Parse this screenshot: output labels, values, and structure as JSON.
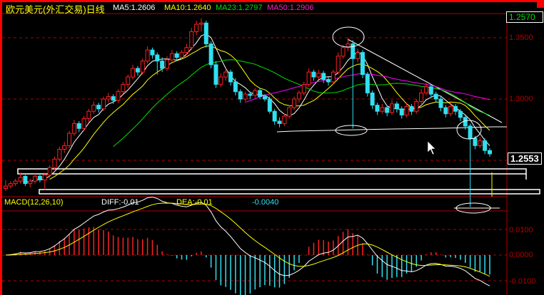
{
  "header": {
    "title": "欧元美元(外汇交易)日线",
    "ma5": "MA5:1.2606",
    "ma10": "MA10:1.2640",
    "ma23": "MA23:1.2797",
    "ma50": "MA50:1.2906"
  },
  "macd_header": {
    "name": "MACD(12,26,10)",
    "diff": "DIFF:-0.01",
    "dea": "DEA:-0.01",
    "macd": "-0.0040"
  },
  "price_axis": {
    "top_value": "1.2570",
    "ticks": [
      "1.3500",
      "1.3000"
    ],
    "current_price": "1.2553"
  },
  "macd_axis": {
    "ticks": [
      "0.0100",
      "0.0000",
      "-0.0100"
    ]
  },
  "colors": {
    "up": "#ff2020",
    "down": "#30e0f0",
    "ma5": "#ffffff",
    "ma10": "#ffff00",
    "ma23": "#00e000",
    "ma50": "#ff00ff",
    "grid": "#b00000"
  },
  "chart_data": {
    "type": "candlestick",
    "ylim": [
      1.21,
      1.37
    ],
    "yticks": [
      1.35,
      1.3,
      1.25
    ],
    "macd_yticks": [
      0.01,
      0,
      -0.01
    ],
    "grid": true,
    "moving_averages": [
      5,
      10,
      23,
      50
    ],
    "macd_params": [
      12,
      26,
      10
    ],
    "candles_ohlc": [
      [
        1.227,
        1.234,
        1.225,
        1.229
      ],
      [
        1.229,
        1.233,
        1.227,
        1.231
      ],
      [
        1.231,
        1.235,
        1.229,
        1.233
      ],
      [
        1.233,
        1.24,
        1.231,
        1.236
      ],
      [
        1.237,
        1.238,
        1.229,
        1.231
      ],
      [
        1.231,
        1.235,
        1.228,
        1.233
      ],
      [
        1.233,
        1.239,
        1.231,
        1.237
      ],
      [
        1.237,
        1.239,
        1.232,
        1.234
      ],
      [
        1.234,
        1.24,
        1.226,
        1.238
      ],
      [
        1.238,
        1.246,
        1.236,
        1.244
      ],
      [
        1.244,
        1.253,
        1.242,
        1.251
      ],
      [
        1.251,
        1.261,
        1.249,
        1.259
      ],
      [
        1.259,
        1.265,
        1.256,
        1.262
      ],
      [
        1.262,
        1.274,
        1.26,
        1.272
      ],
      [
        1.272,
        1.283,
        1.27,
        1.28
      ],
      [
        1.28,
        1.282,
        1.273,
        1.276
      ],
      [
        1.276,
        1.286,
        1.274,
        1.284
      ],
      [
        1.284,
        1.292,
        1.281,
        1.29
      ],
      [
        1.29,
        1.298,
        1.288,
        1.295
      ],
      [
        1.295,
        1.297,
        1.289,
        1.292
      ],
      [
        1.292,
        1.302,
        1.29,
        1.3
      ],
      [
        1.3,
        1.305,
        1.297,
        1.302
      ],
      [
        1.302,
        1.304,
        1.296,
        1.299
      ],
      [
        1.299,
        1.308,
        1.297,
        1.306
      ],
      [
        1.306,
        1.314,
        1.304,
        1.312
      ],
      [
        1.312,
        1.32,
        1.309,
        1.318
      ],
      [
        1.318,
        1.328,
        1.316,
        1.325
      ],
      [
        1.325,
        1.327,
        1.319,
        1.322
      ],
      [
        1.322,
        1.333,
        1.32,
        1.331
      ],
      [
        1.331,
        1.343,
        1.329,
        1.34
      ],
      [
        1.34,
        1.342,
        1.333,
        1.336
      ],
      [
        1.336,
        1.338,
        1.32,
        1.331
      ],
      [
        1.331,
        1.334,
        1.322,
        1.325
      ],
      [
        1.325,
        1.335,
        1.323,
        1.332
      ],
      [
        1.332,
        1.34,
        1.33,
        1.337
      ],
      [
        1.337,
        1.339,
        1.331,
        1.334
      ],
      [
        1.334,
        1.34,
        1.332,
        1.338
      ],
      [
        1.338,
        1.345,
        1.336,
        1.342
      ],
      [
        1.342,
        1.358,
        1.34,
        1.355
      ],
      [
        1.355,
        1.364,
        1.352,
        1.361
      ],
      [
        1.361,
        1.366,
        1.355,
        1.362
      ],
      [
        1.362,
        1.364,
        1.342,
        1.345
      ],
      [
        1.345,
        1.347,
        1.325,
        1.328
      ],
      [
        1.328,
        1.331,
        1.309,
        1.312
      ],
      [
        1.312,
        1.321,
        1.31,
        1.318
      ],
      [
        1.318,
        1.325,
        1.315,
        1.322
      ],
      [
        1.322,
        1.324,
        1.311,
        1.314
      ],
      [
        1.314,
        1.317,
        1.303,
        1.306
      ],
      [
        1.306,
        1.308,
        1.297,
        1.3
      ],
      [
        1.3,
        1.306,
        1.298,
        1.304
      ],
      [
        1.304,
        1.306,
        1.3,
        1.303
      ],
      [
        1.303,
        1.309,
        1.301,
        1.307
      ],
      [
        1.307,
        1.309,
        1.3,
        1.302
      ],
      [
        1.302,
        1.304,
        1.298,
        1.3
      ],
      [
        1.3,
        1.302,
        1.288,
        1.29
      ],
      [
        1.29,
        1.292,
        1.279,
        1.282
      ],
      [
        1.282,
        1.285,
        1.277,
        1.28
      ],
      [
        1.28,
        1.288,
        1.278,
        1.286
      ],
      [
        1.286,
        1.295,
        1.284,
        1.293
      ],
      [
        1.293,
        1.302,
        1.291,
        1.3
      ],
      [
        1.3,
        1.307,
        1.297,
        1.305
      ],
      [
        1.305,
        1.314,
        1.303,
        1.312
      ],
      [
        1.312,
        1.325,
        1.31,
        1.322
      ],
      [
        1.322,
        1.324,
        1.315,
        1.318
      ],
      [
        1.318,
        1.324,
        1.316,
        1.321
      ],
      [
        1.321,
        1.323,
        1.313,
        1.316
      ],
      [
        1.316,
        1.318,
        1.311,
        1.314
      ],
      [
        1.314,
        1.324,
        1.312,
        1.322
      ],
      [
        1.322,
        1.338,
        1.32,
        1.335
      ],
      [
        1.335,
        1.344,
        1.333,
        1.342
      ],
      [
        1.342,
        1.35,
        1.339,
        1.345
      ],
      [
        1.345,
        1.348,
        1.276,
        1.333
      ],
      [
        1.333,
        1.341,
        1.33,
        1.338
      ],
      [
        1.338,
        1.34,
        1.317,
        1.32
      ],
      [
        1.32,
        1.322,
        1.302,
        1.305
      ],
      [
        1.305,
        1.307,
        1.292,
        1.295
      ],
      [
        1.295,
        1.297,
        1.287,
        1.29
      ],
      [
        1.29,
        1.296,
        1.288,
        1.293
      ],
      [
        1.293,
        1.295,
        1.286,
        1.289
      ],
      [
        1.289,
        1.299,
        1.287,
        1.296
      ],
      [
        1.296,
        1.298,
        1.289,
        1.292
      ],
      [
        1.292,
        1.294,
        1.284,
        1.287
      ],
      [
        1.287,
        1.297,
        1.285,
        1.294
      ],
      [
        1.294,
        1.296,
        1.287,
        1.29
      ],
      [
        1.29,
        1.3,
        1.288,
        1.298
      ],
      [
        1.298,
        1.308,
        1.296,
        1.305
      ],
      [
        1.305,
        1.313,
        1.303,
        1.31
      ],
      [
        1.31,
        1.312,
        1.301,
        1.304
      ],
      [
        1.304,
        1.306,
        1.297,
        1.3
      ],
      [
        1.3,
        1.302,
        1.29,
        1.293
      ],
      [
        1.293,
        1.295,
        1.285,
        1.288
      ],
      [
        1.288,
        1.297,
        1.286,
        1.294
      ],
      [
        1.294,
        1.296,
        1.287,
        1.29
      ],
      [
        1.29,
        1.292,
        1.282,
        1.285
      ],
      [
        1.285,
        1.287,
        1.275,
        1.278
      ],
      [
        1.278,
        1.28,
        1.212,
        1.268
      ],
      [
        1.268,
        1.27,
        1.259,
        1.262
      ],
      [
        1.262,
        1.269,
        1.26,
        1.266
      ],
      [
        1.266,
        1.268,
        1.255,
        1.258
      ],
      [
        1.258,
        1.26,
        1.253,
        1.2553
      ]
    ]
  }
}
